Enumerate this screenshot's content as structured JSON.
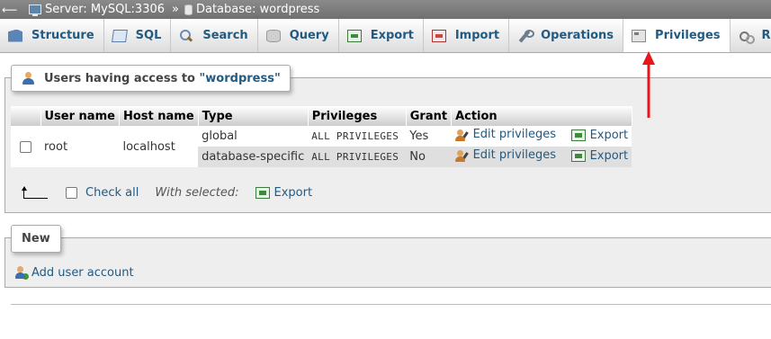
{
  "breadcrumb": {
    "back_glyph": "⟵",
    "server": "Server: MySQL:3306",
    "separator": "»",
    "database": "Database: wordpress"
  },
  "tabs": [
    {
      "label": "Structure",
      "icon": "structure-icon"
    },
    {
      "label": "SQL",
      "icon": "sql-icon"
    },
    {
      "label": "Search",
      "icon": "search-icon"
    },
    {
      "label": "Query",
      "icon": "query-icon"
    },
    {
      "label": "Export",
      "icon": "export-icon"
    },
    {
      "label": "Import",
      "icon": "import-icon"
    },
    {
      "label": "Operations",
      "icon": "wrench-icon"
    },
    {
      "label": "Privileges",
      "icon": "privileges-icon",
      "active": true
    },
    {
      "label": "Routines",
      "icon": "routines-icon"
    }
  ],
  "users_panel": {
    "legend_prefix": "Users having access to ",
    "legend_db": "\"wordpress\"",
    "columns": [
      "",
      "User name",
      "Host name",
      "Type",
      "Privileges",
      "Grant",
      "Action"
    ],
    "user": "root",
    "host": "localhost",
    "rows": [
      {
        "type": "global",
        "privileges": "ALL PRIVILEGES",
        "grant": "Yes",
        "edit": "Edit privileges",
        "export": "Export"
      },
      {
        "type": "database-specific",
        "privileges": "ALL PRIVILEGES",
        "grant": "No",
        "edit": "Edit privileges",
        "export": "Export"
      }
    ],
    "check_all": "Check all",
    "with_selected": "With selected:",
    "export": "Export"
  },
  "new_panel": {
    "legend": "New",
    "add_user": "Add user account"
  },
  "colors": {
    "link": "#235a81",
    "annotation_arrow": "#e8151b",
    "breadcrumb_bg": "#7d7d7d"
  }
}
